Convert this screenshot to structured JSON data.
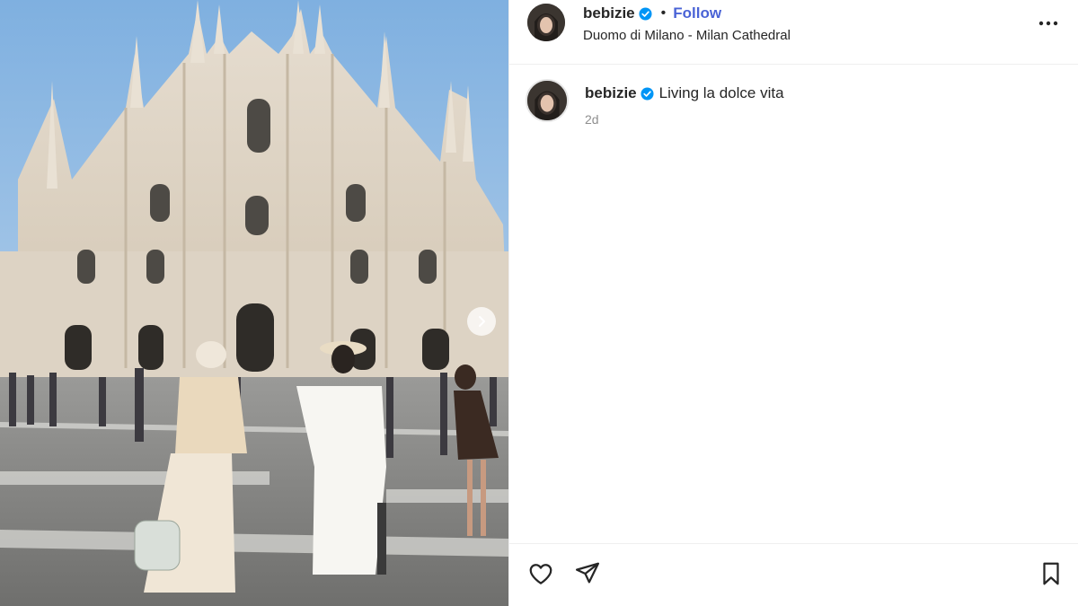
{
  "post": {
    "username": "bebizie",
    "follow_label": "Follow",
    "separator": "•",
    "location": "Duomo di Milano - Milan Cathedral",
    "caption": "Living la dolce vita",
    "timestamp": "2d"
  },
  "icons": {
    "verified": "verified-badge-icon",
    "more": "more-options-icon",
    "next": "chevron-right-icon",
    "like": "heart-icon",
    "share": "paper-plane-icon",
    "save": "bookmark-icon"
  },
  "colors": {
    "verified_blue": "#0095f6",
    "follow_blue": "#4a63d6",
    "text": "#262626",
    "secondary": "#8e8e8e"
  }
}
